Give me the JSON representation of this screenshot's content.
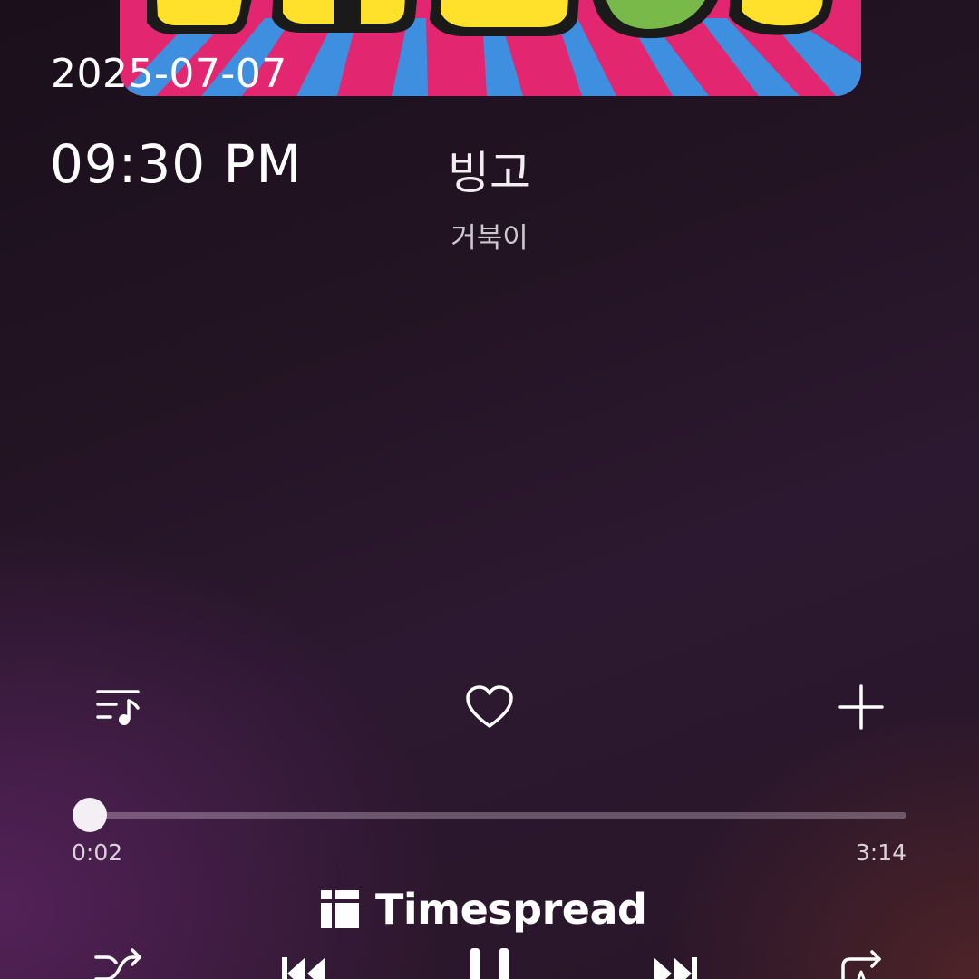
{
  "status": {
    "date": "2025-07-07",
    "time": "09:30 PM"
  },
  "track": {
    "title": "빙고",
    "artist": "거북이",
    "elapsed": "0:02",
    "duration": "3:14",
    "progress_fraction": 0.01
  },
  "actions": {
    "queue_icon": "queue-music-icon",
    "like_icon": "heart-outline-icon",
    "add_icon": "plus-icon"
  },
  "controls": {
    "shuffle_icon": "shuffle-icon",
    "previous_icon": "skip-previous-icon",
    "play_pause_icon": "pause-icon",
    "next_icon": "skip-next-icon",
    "repeat_icon": "repeat-icon"
  },
  "watermark": {
    "text": "Timespread"
  },
  "colors": {
    "background": "#231424",
    "text": "#ffffff",
    "seek_track": "#6a5468",
    "seek_knob": "#f4eef5",
    "album_pink": "#e2266f",
    "album_blue": "#3f8fe0",
    "album_yellow": "#ffe02a",
    "album_green": "#79b94a"
  }
}
